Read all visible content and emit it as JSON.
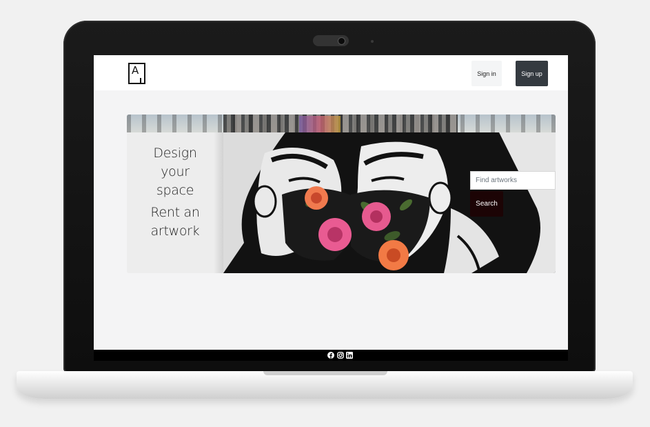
{
  "brand": {
    "logo_letter": "A"
  },
  "nav": {
    "signin_label": "Sign in",
    "signup_label": "Sign up"
  },
  "hero": {
    "tagline_1": [
      "Design",
      "your",
      "space"
    ],
    "tagline_2": [
      "Rent an",
      "artwork"
    ]
  },
  "search": {
    "placeholder": "Find artworks",
    "value": "",
    "button_label": "Search"
  },
  "footer": {
    "social_icons": [
      "facebook-icon",
      "instagram-icon",
      "linkedin-icon"
    ]
  },
  "colors": {
    "signup_bg": "#343a40",
    "search_button_bg": "#1c0405",
    "footer_bg": "#000000",
    "page_bg": "#f4f4f5"
  }
}
